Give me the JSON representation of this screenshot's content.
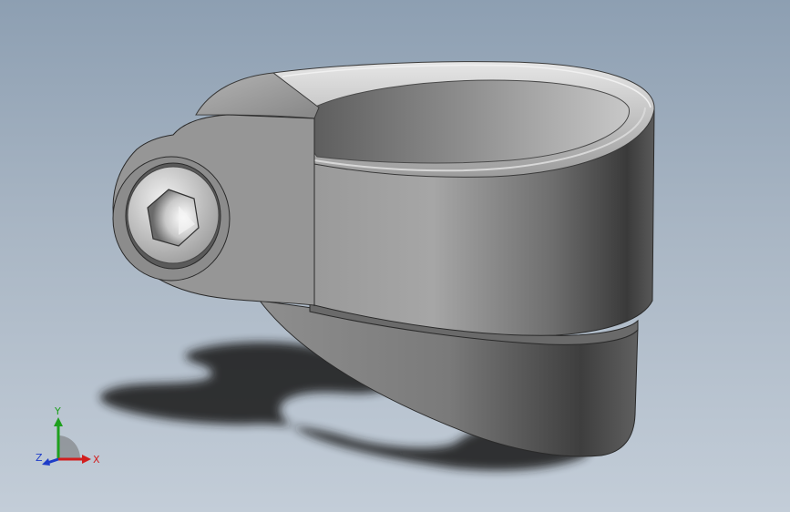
{
  "viewport": {
    "background_top": "#8d9fb2",
    "background_bottom": "#c3cdd8"
  },
  "model": {
    "part": "seat-post-clamp",
    "fastener": "hex-socket-bolt",
    "body_color": "#8a8a8a",
    "shadow_color": "#1a1a1a"
  },
  "triad": {
    "x_label": "X",
    "y_label": "Y",
    "z_label": "Z",
    "x_color": "#d21e1e",
    "y_color": "#1ea01e",
    "z_color": "#1e3cc8"
  }
}
